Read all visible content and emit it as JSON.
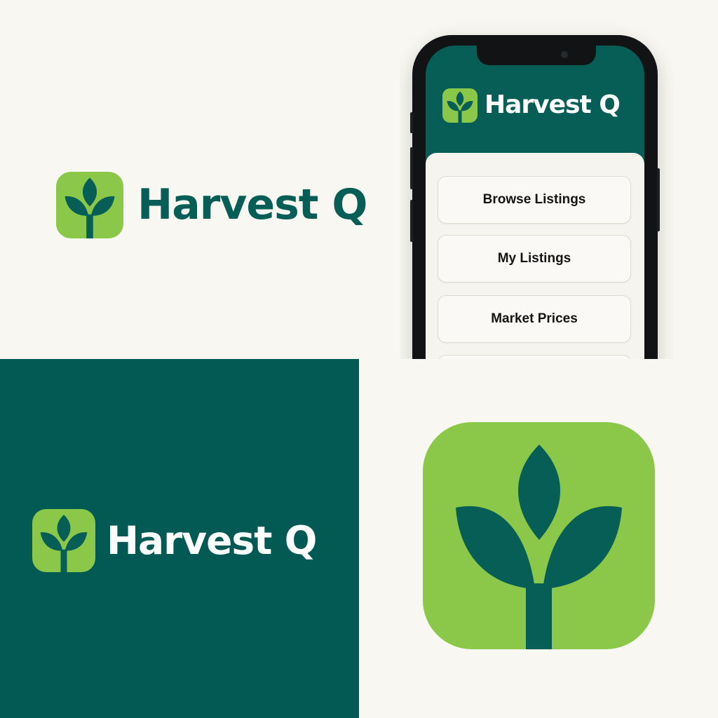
{
  "brand": {
    "name": "Harvest Q",
    "colors": {
      "dark_green": "#075e56",
      "panel_green": "#035a54",
      "lime_green": "#8bc84a",
      "background": "#f8f7f2",
      "white": "#ffffff"
    },
    "icon": "sprout-icon"
  },
  "phone": {
    "menu": [
      {
        "label": "Browse Listings"
      },
      {
        "label": "My Listings"
      },
      {
        "label": "Market Prices"
      },
      {
        "label": ""
      }
    ]
  }
}
